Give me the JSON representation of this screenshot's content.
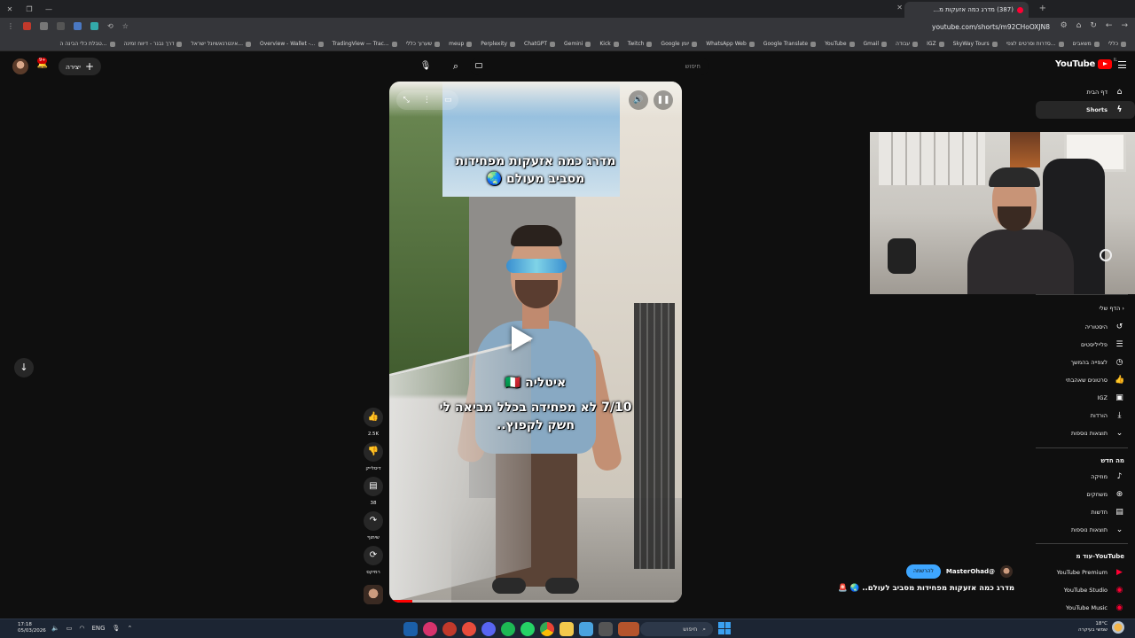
{
  "browser": {
    "tab_title": "(387) מדרג כמה אזעקות מ...",
    "url": "youtube.com/shorts/m92CHoOXJN8",
    "bookmarks": [
      "כללי",
      "משאבים",
      "סדרות וסרטים לצפי...",
      "SkyWay Tours",
      "IGZ",
      "עבודה",
      "Gmail",
      "YouTube",
      "Google Translate",
      "WhatsApp Web",
      "Google יומן",
      "Twitch",
      "Kick",
      "Gemini",
      "ChatGPT",
      "Perplexity",
      "meup",
      "שערוך כללי",
      "TradingView — Trac...",
      "Overview - Wallet -...",
      "אינטרנאשיונל ישראל...",
      "דרך נבנר - דיווח זמינה",
      "טבלת כלי הבינה ה..."
    ]
  },
  "header": {
    "logo_text": "YouTube",
    "logo_country": "IL",
    "search_placeholder": "חיפוש",
    "create_label": "יצירה",
    "notification_count": "9+"
  },
  "sidebar": {
    "top_items": [
      {
        "label": "דף הבית",
        "icon": "home-icon"
      },
      {
        "label": "Shorts",
        "icon": "shorts-icon",
        "active": true
      }
    ],
    "you_heading": "הדף שלי",
    "you_items": [
      {
        "label": "היסטוריה",
        "icon": "history-icon"
      },
      {
        "label": "פלייליסטים",
        "icon": "playlists-icon"
      },
      {
        "label": "לצפייה בהמשך",
        "icon": "watch-later-icon"
      },
      {
        "label": "סרטונים שאהבתי",
        "icon": "like-icon"
      },
      {
        "label": "IGZ",
        "icon": "video-icon"
      },
      {
        "label": "הורדות",
        "icon": "download-icon"
      },
      {
        "label": "תוצאות נוספות",
        "icon": "chevron-down-icon"
      }
    ],
    "whats_new_heading": "מה חדש",
    "whats_new_items": [
      {
        "label": "מוזיקה",
        "icon": "music-icon"
      },
      {
        "label": "משחקים",
        "icon": "gaming-icon"
      },
      {
        "label": "חדשות",
        "icon": "news-icon"
      },
      {
        "label": "תוצאות נוספות",
        "icon": "chevron-down-icon"
      }
    ],
    "more_heading": "עוד מ-YouTube",
    "more_items": [
      {
        "label": "YouTube Premium",
        "icon": "youtube-premium-icon"
      },
      {
        "label": "YouTube Studio",
        "icon": "youtube-studio-icon"
      },
      {
        "label": "YouTube Music",
        "icon": "youtube-music-icon"
      }
    ]
  },
  "video": {
    "caption_top_line1": "מדרג כמה אזעקות מפחידות",
    "caption_top_line2": "מסביב מעולם 🌏",
    "caption_country": "איטליה 🇮🇹",
    "caption_rating_line1": "7/10 לא מפחידה בכלל מביאה לי",
    "caption_rating_line2": "חשק לקפוץ..",
    "progress": 0.08
  },
  "actions": {
    "like_count": "2.5K",
    "dislike_label": "דיסלייק",
    "comment_count": "38",
    "share_label": "שיתוף",
    "remix_label": "רמיקס"
  },
  "channel": {
    "name": "@MasterOhad",
    "subscribe_label": "להרשמה",
    "title": "מדרג כמה אזעקות מפחידות מסביב לעולם.. 🌏 🚨"
  },
  "taskbar": {
    "time": "17:18",
    "date": "05/03/2026",
    "language": "ENG",
    "search_label": "חיפוש",
    "weather_temp": "18°C",
    "weather_desc": "שמשי בעיקרה"
  }
}
